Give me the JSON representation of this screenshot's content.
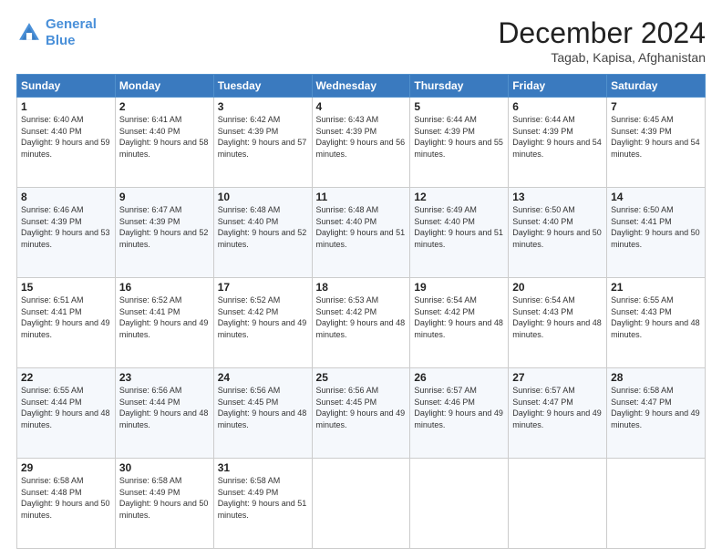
{
  "header": {
    "logo_line1": "General",
    "logo_line2": "Blue",
    "month": "December 2024",
    "location": "Tagab, Kapisa, Afghanistan"
  },
  "weekdays": [
    "Sunday",
    "Monday",
    "Tuesday",
    "Wednesday",
    "Thursday",
    "Friday",
    "Saturday"
  ],
  "weeks": [
    [
      {
        "day": "1",
        "sunrise": "Sunrise: 6:40 AM",
        "sunset": "Sunset: 4:40 PM",
        "daylight": "Daylight: 9 hours and 59 minutes."
      },
      {
        "day": "2",
        "sunrise": "Sunrise: 6:41 AM",
        "sunset": "Sunset: 4:40 PM",
        "daylight": "Daylight: 9 hours and 58 minutes."
      },
      {
        "day": "3",
        "sunrise": "Sunrise: 6:42 AM",
        "sunset": "Sunset: 4:39 PM",
        "daylight": "Daylight: 9 hours and 57 minutes."
      },
      {
        "day": "4",
        "sunrise": "Sunrise: 6:43 AM",
        "sunset": "Sunset: 4:39 PM",
        "daylight": "Daylight: 9 hours and 56 minutes."
      },
      {
        "day": "5",
        "sunrise": "Sunrise: 6:44 AM",
        "sunset": "Sunset: 4:39 PM",
        "daylight": "Daylight: 9 hours and 55 minutes."
      },
      {
        "day": "6",
        "sunrise": "Sunrise: 6:44 AM",
        "sunset": "Sunset: 4:39 PM",
        "daylight": "Daylight: 9 hours and 54 minutes."
      },
      {
        "day": "7",
        "sunrise": "Sunrise: 6:45 AM",
        "sunset": "Sunset: 4:39 PM",
        "daylight": "Daylight: 9 hours and 54 minutes."
      }
    ],
    [
      {
        "day": "8",
        "sunrise": "Sunrise: 6:46 AM",
        "sunset": "Sunset: 4:39 PM",
        "daylight": "Daylight: 9 hours and 53 minutes."
      },
      {
        "day": "9",
        "sunrise": "Sunrise: 6:47 AM",
        "sunset": "Sunset: 4:39 PM",
        "daylight": "Daylight: 9 hours and 52 minutes."
      },
      {
        "day": "10",
        "sunrise": "Sunrise: 6:48 AM",
        "sunset": "Sunset: 4:40 PM",
        "daylight": "Daylight: 9 hours and 52 minutes."
      },
      {
        "day": "11",
        "sunrise": "Sunrise: 6:48 AM",
        "sunset": "Sunset: 4:40 PM",
        "daylight": "Daylight: 9 hours and 51 minutes."
      },
      {
        "day": "12",
        "sunrise": "Sunrise: 6:49 AM",
        "sunset": "Sunset: 4:40 PM",
        "daylight": "Daylight: 9 hours and 51 minutes."
      },
      {
        "day": "13",
        "sunrise": "Sunrise: 6:50 AM",
        "sunset": "Sunset: 4:40 PM",
        "daylight": "Daylight: 9 hours and 50 minutes."
      },
      {
        "day": "14",
        "sunrise": "Sunrise: 6:50 AM",
        "sunset": "Sunset: 4:41 PM",
        "daylight": "Daylight: 9 hours and 50 minutes."
      }
    ],
    [
      {
        "day": "15",
        "sunrise": "Sunrise: 6:51 AM",
        "sunset": "Sunset: 4:41 PM",
        "daylight": "Daylight: 9 hours and 49 minutes."
      },
      {
        "day": "16",
        "sunrise": "Sunrise: 6:52 AM",
        "sunset": "Sunset: 4:41 PM",
        "daylight": "Daylight: 9 hours and 49 minutes."
      },
      {
        "day": "17",
        "sunrise": "Sunrise: 6:52 AM",
        "sunset": "Sunset: 4:42 PM",
        "daylight": "Daylight: 9 hours and 49 minutes."
      },
      {
        "day": "18",
        "sunrise": "Sunrise: 6:53 AM",
        "sunset": "Sunset: 4:42 PM",
        "daylight": "Daylight: 9 hours and 48 minutes."
      },
      {
        "day": "19",
        "sunrise": "Sunrise: 6:54 AM",
        "sunset": "Sunset: 4:42 PM",
        "daylight": "Daylight: 9 hours and 48 minutes."
      },
      {
        "day": "20",
        "sunrise": "Sunrise: 6:54 AM",
        "sunset": "Sunset: 4:43 PM",
        "daylight": "Daylight: 9 hours and 48 minutes."
      },
      {
        "day": "21",
        "sunrise": "Sunrise: 6:55 AM",
        "sunset": "Sunset: 4:43 PM",
        "daylight": "Daylight: 9 hours and 48 minutes."
      }
    ],
    [
      {
        "day": "22",
        "sunrise": "Sunrise: 6:55 AM",
        "sunset": "Sunset: 4:44 PM",
        "daylight": "Daylight: 9 hours and 48 minutes."
      },
      {
        "day": "23",
        "sunrise": "Sunrise: 6:56 AM",
        "sunset": "Sunset: 4:44 PM",
        "daylight": "Daylight: 9 hours and 48 minutes."
      },
      {
        "day": "24",
        "sunrise": "Sunrise: 6:56 AM",
        "sunset": "Sunset: 4:45 PM",
        "daylight": "Daylight: 9 hours and 48 minutes."
      },
      {
        "day": "25",
        "sunrise": "Sunrise: 6:56 AM",
        "sunset": "Sunset: 4:45 PM",
        "daylight": "Daylight: 9 hours and 49 minutes."
      },
      {
        "day": "26",
        "sunrise": "Sunrise: 6:57 AM",
        "sunset": "Sunset: 4:46 PM",
        "daylight": "Daylight: 9 hours and 49 minutes."
      },
      {
        "day": "27",
        "sunrise": "Sunrise: 6:57 AM",
        "sunset": "Sunset: 4:47 PM",
        "daylight": "Daylight: 9 hours and 49 minutes."
      },
      {
        "day": "28",
        "sunrise": "Sunrise: 6:58 AM",
        "sunset": "Sunset: 4:47 PM",
        "daylight": "Daylight: 9 hours and 49 minutes."
      }
    ],
    [
      {
        "day": "29",
        "sunrise": "Sunrise: 6:58 AM",
        "sunset": "Sunset: 4:48 PM",
        "daylight": "Daylight: 9 hours and 50 minutes."
      },
      {
        "day": "30",
        "sunrise": "Sunrise: 6:58 AM",
        "sunset": "Sunset: 4:49 PM",
        "daylight": "Daylight: 9 hours and 50 minutes."
      },
      {
        "day": "31",
        "sunrise": "Sunrise: 6:58 AM",
        "sunset": "Sunset: 4:49 PM",
        "daylight": "Daylight: 9 hours and 51 minutes."
      },
      null,
      null,
      null,
      null
    ]
  ]
}
